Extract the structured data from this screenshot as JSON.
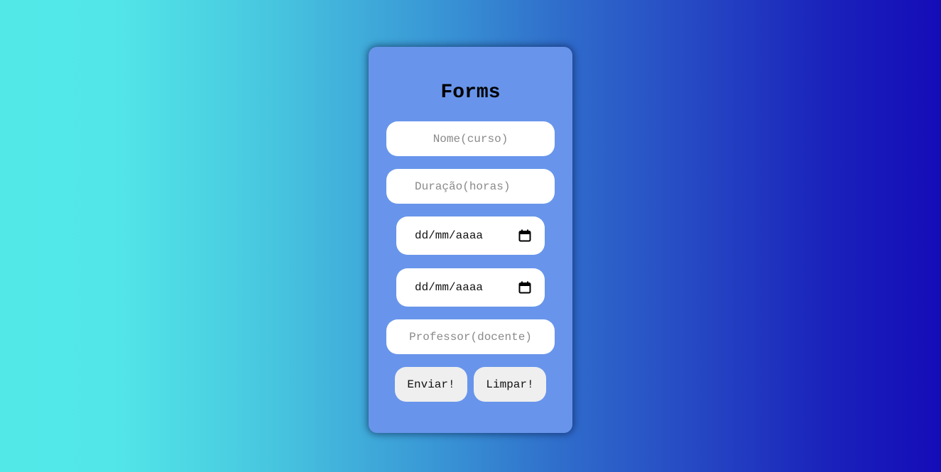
{
  "colors": {
    "card_background": "#6895eb",
    "gradient_left": "#52e8e8",
    "gradient_right": "#150cb8",
    "field_background": "#ffffff",
    "button_background": "#efefef"
  },
  "form": {
    "title": "Forms",
    "nome_placeholder": "Nome(curso)",
    "duracao_placeholder": "Duração(horas)",
    "data_inicio_text": "dd/mm/aaaa",
    "data_fim_text": "dd/mm/aaaa",
    "calendar_icon": "calendar-icon",
    "professor_placeholder": "Professor(docente)",
    "enviar_label": "Enviar!",
    "limpar_label": "Limpar!"
  }
}
